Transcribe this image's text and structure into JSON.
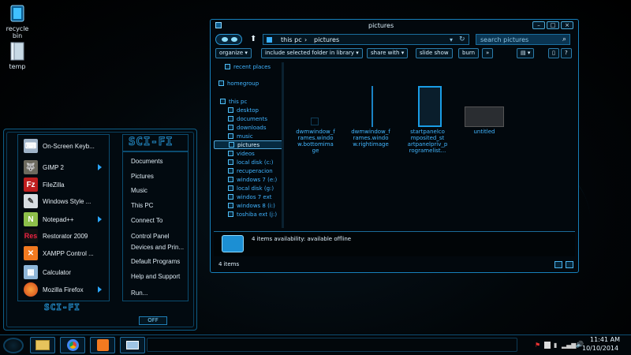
{
  "desktop": {
    "icons": [
      {
        "label_line1": "recycle",
        "label_line2": "bin"
      },
      {
        "label_line1": "temp",
        "label_line2": ""
      }
    ]
  },
  "start_menu": {
    "logo_top": "SCI-FI",
    "logo_bottom": "SCI-FI",
    "programs": [
      {
        "label": "On-Screen Keyb...",
        "icon": "keyboard-icon",
        "has_arrow": false
      },
      {
        "label": "GIMP 2",
        "icon": "gimp-icon",
        "has_arrow": true
      },
      {
        "label": "FileZilla",
        "icon": "filezilla-icon",
        "has_arrow": false
      },
      {
        "label": "Windows Style ...",
        "icon": "windows-style-icon",
        "has_arrow": false
      },
      {
        "label": "Notepad++",
        "icon": "notepadpp-icon",
        "has_arrow": true
      },
      {
        "label": "Restorator 2009",
        "icon": "restorator-icon",
        "has_arrow": false
      },
      {
        "label": "XAMPP Control ...",
        "icon": "xampp-icon",
        "has_arrow": false
      },
      {
        "label": "Calculator",
        "icon": "calculator-icon",
        "has_arrow": false
      },
      {
        "label": "Mozilla Firefox",
        "icon": "firefox-icon",
        "has_arrow": true
      }
    ],
    "links": [
      "Documents",
      "Pictures",
      "Music",
      "This PC",
      "Connect To",
      "Control Panel",
      "Devices and Prin...",
      "Default Programs",
      "Help and Support",
      "Run..."
    ],
    "power_label": "OFF"
  },
  "explorer": {
    "title": "pictures",
    "window_buttons": {
      "minimize": "–",
      "maximize": "□",
      "close": "×"
    },
    "address": {
      "root": "this pc",
      "separator": "›",
      "current": "pictures"
    },
    "search_placeholder": "search pictures",
    "toolbar": [
      "organize ▾",
      "include selected folder in library ▾",
      "share with ▾",
      "slide show",
      "burn",
      "»"
    ],
    "nav_items": [
      {
        "label": "recent places",
        "selected": false
      },
      {
        "label": "homegroup",
        "selected": false
      },
      {
        "label": "this pc",
        "selected": false
      },
      {
        "label": "desktop",
        "selected": false
      },
      {
        "label": "documents",
        "selected": false
      },
      {
        "label": "downloads",
        "selected": false
      },
      {
        "label": "music",
        "selected": false
      },
      {
        "label": "pictures",
        "selected": true
      },
      {
        "label": "videos",
        "selected": false
      },
      {
        "label": "local disk (c:)",
        "selected": false
      },
      {
        "label": "recuperacion",
        "selected": false
      },
      {
        "label": "windows 7 (e:)",
        "selected": false
      },
      {
        "label": "local disk (g:)",
        "selected": false
      },
      {
        "label": "windos 7 ext",
        "selected": false
      },
      {
        "label": "windows 8 (i:)",
        "selected": false
      },
      {
        "label": "toshiba ext (j:)",
        "selected": false
      }
    ],
    "files": [
      {
        "name_lines": [
          "dwmwindow_f",
          "rames.windo",
          "w.bottomima",
          "ge"
        ]
      },
      {
        "name_lines": [
          "dwmwindow_f",
          "rames.windo",
          "w.rightimage"
        ]
      },
      {
        "name_lines": [
          "startpanelco",
          "mposited_st",
          "artpanelpriv_p",
          "rogramelist..."
        ]
      },
      {
        "name_lines": [
          "untitled"
        ]
      }
    ],
    "preview_text": "4 items  availability:   available offline",
    "status_text": "4 items"
  },
  "taskbar": {
    "pinned": [
      "explorer-icon",
      "chrome-icon",
      "xampp-icon",
      "remote-desktop-icon"
    ],
    "time": "11:41 AM",
    "date": "10/10/2014"
  },
  "colors": {
    "accent": "#1a9ae0",
    "text": "#3fb3ff"
  }
}
